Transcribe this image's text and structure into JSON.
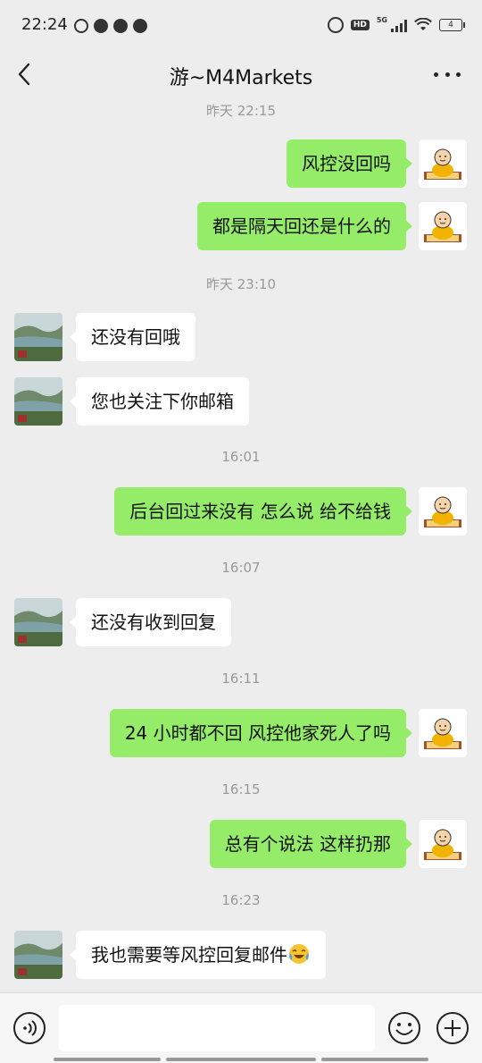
{
  "status_bar": {
    "time": "22:24",
    "battery": "4",
    "network": "5G"
  },
  "header": {
    "title": "游~M4Markets"
  },
  "messages": [
    {
      "type": "timestamp",
      "text": "昨天 22:15"
    },
    {
      "type": "sent",
      "text": "风控没回吗"
    },
    {
      "type": "sent",
      "text": "都是隔天回还是什么的"
    },
    {
      "type": "timestamp",
      "text": "昨天 23:10"
    },
    {
      "type": "received",
      "text": "还没有回哦"
    },
    {
      "type": "received",
      "text": "您也关注下你邮箱"
    },
    {
      "type": "timestamp",
      "text": "16:01"
    },
    {
      "type": "sent",
      "text": "后台回过来没有 怎么说 给不给钱"
    },
    {
      "type": "timestamp",
      "text": "16:07"
    },
    {
      "type": "received",
      "text": "还没有收到回复"
    },
    {
      "type": "timestamp",
      "text": "16:11"
    },
    {
      "type": "sent",
      "text": "24 小时都不回  风控他家死人了吗"
    },
    {
      "type": "timestamp",
      "text": "16:15"
    },
    {
      "type": "sent",
      "text": "总有个说法 这样扔那"
    },
    {
      "type": "timestamp",
      "text": "16:23"
    },
    {
      "type": "received",
      "text": "我也需要等风控回复邮件",
      "emoji": "crying-laughing-face-icon"
    }
  ],
  "input": {
    "placeholder": ""
  },
  "colors": {
    "sent_bubble": "#95ec69",
    "received_bubble": "#ffffff",
    "background": "#ededed"
  }
}
